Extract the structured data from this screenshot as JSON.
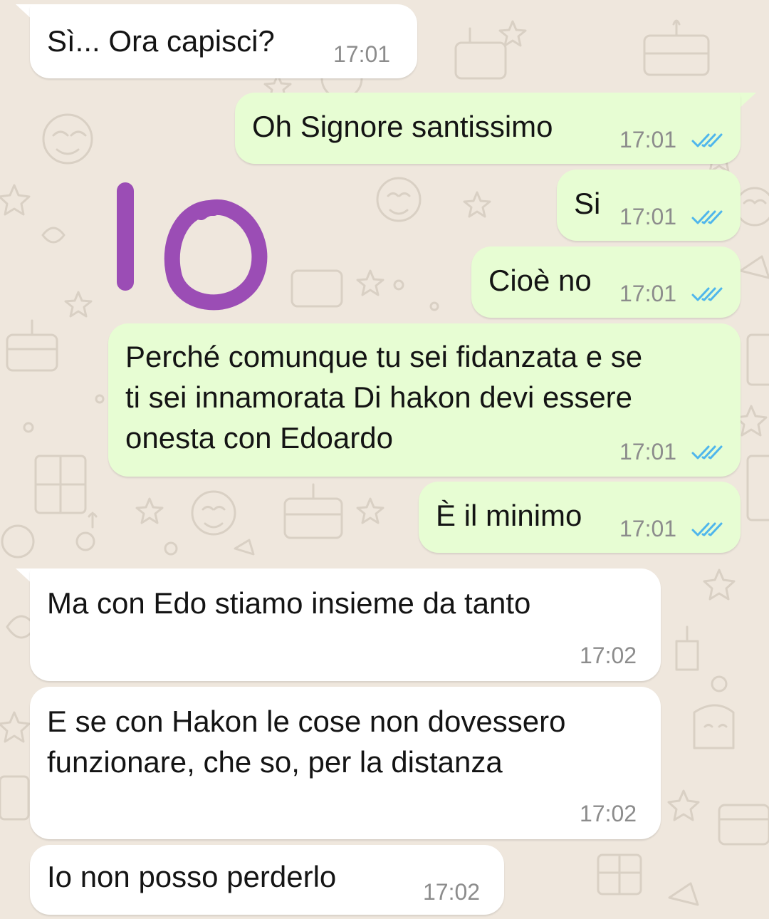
{
  "chat": {
    "messages": [
      {
        "direction": "incoming",
        "text": "Sì... Ora capisci?",
        "time": "17:01"
      },
      {
        "direction": "outgoing",
        "text": "Oh Signore santissimo",
        "time": "17:01",
        "status": "read"
      },
      {
        "direction": "outgoing",
        "text": "Si",
        "time": "17:01",
        "status": "read"
      },
      {
        "direction": "outgoing",
        "text": "Cioè no",
        "time": "17:01",
        "status": "read"
      },
      {
        "direction": "outgoing",
        "text": "Perché comunque tu sei fidanzata e se\nti sei innamorata Di hakon devi essere\nonesta con Edoardo",
        "time": "17:01",
        "status": "read"
      },
      {
        "direction": "outgoing",
        "text": "È il minimo",
        "time": "17:01",
        "status": "read"
      },
      {
        "direction": "incoming",
        "text": "Ma con Edo stiamo insieme da tanto",
        "time": "17:02"
      },
      {
        "direction": "incoming",
        "text": "E se con Hakon le cose non dovessero\nfunzionare, che so, per la distanza",
        "time": "17:02"
      },
      {
        "direction": "incoming",
        "text": "Io non posso perderlo",
        "time": "17:02"
      }
    ]
  },
  "colors": {
    "wallpaper": "#efe7dd",
    "incoming_bubble": "#ffffff",
    "outgoing_bubble": "#e7fdd3",
    "read_ticks": "#4fb6ec",
    "annotation": "#9b4db5"
  },
  "icons": {
    "read_receipt": "double-check-icon",
    "annotation": "handwritten-mark"
  }
}
